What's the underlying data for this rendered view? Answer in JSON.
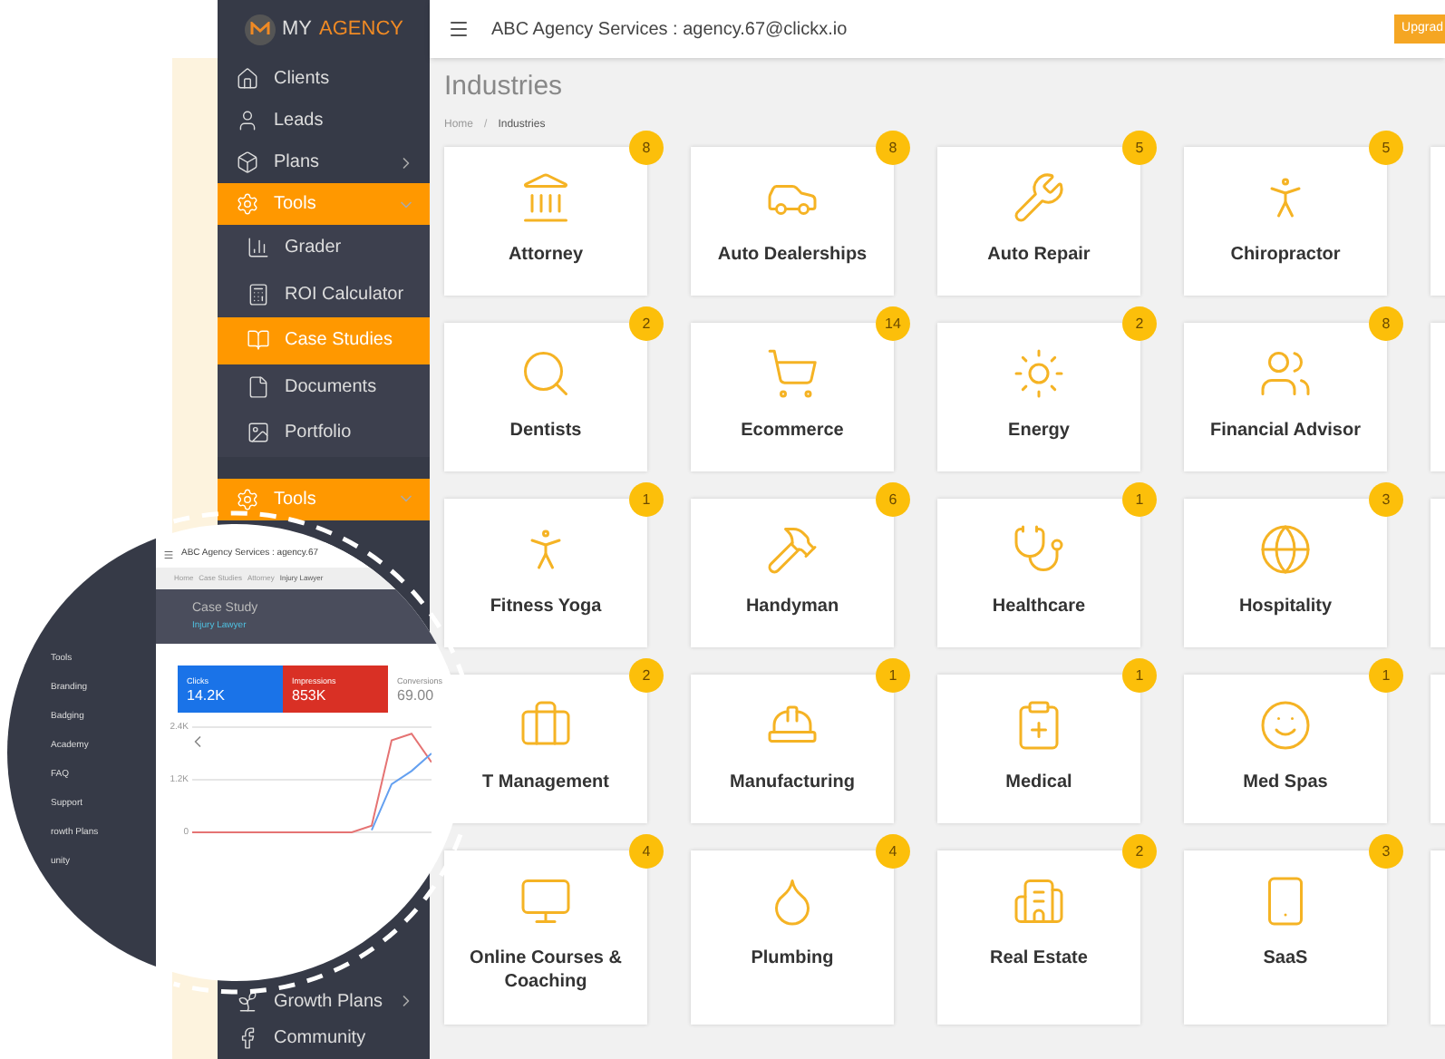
{
  "logo": {
    "prefix": "MY",
    "suffix": "AGENCY"
  },
  "sidebar": {
    "items": [
      {
        "label": "Clients",
        "kind": "main",
        "selected": false
      },
      {
        "label": "Leads",
        "kind": "main",
        "selected": false
      },
      {
        "label": "Plans",
        "kind": "main",
        "expanded": false,
        "selected": false
      },
      {
        "label": "Tools",
        "kind": "main",
        "expanded": true,
        "selected": true
      },
      {
        "label": "Grader",
        "kind": "sub",
        "selected": false
      },
      {
        "label": "ROI Calculator",
        "kind": "sub",
        "selected": false
      },
      {
        "label": "Case Studies",
        "kind": "sub",
        "selected": true
      },
      {
        "label": "Documents",
        "kind": "sub",
        "selected": false
      },
      {
        "label": "Portfolio",
        "kind": "sub",
        "selected": false
      },
      {
        "label": "Tools",
        "kind": "main",
        "expanded": true,
        "selected": true
      }
    ],
    "bottom_items": [
      {
        "label": "Growth Plans",
        "expanded": false
      },
      {
        "label": "Community"
      }
    ]
  },
  "header": {
    "title": "ABC Agency Services : agency.67@clickx.io",
    "button": "Upgrad"
  },
  "page": {
    "title": "Industries",
    "breadcrumb": [
      "Home",
      "Industries"
    ],
    "breadcrumb_separator": "/"
  },
  "cards": [
    {
      "label": "Attorney",
      "count": "8"
    },
    {
      "label": "Auto Dealerships",
      "count": "8"
    },
    {
      "label": "Auto Repair",
      "count": "5"
    },
    {
      "label": "Chiropractor",
      "count": "5"
    },
    {
      "label": "Dentists",
      "count": "2"
    },
    {
      "label": "Ecommerce",
      "count": "14"
    },
    {
      "label": "Energy",
      "count": "2"
    },
    {
      "label": "Financial Advisor",
      "count": "8"
    },
    {
      "label": "Fitness Yoga",
      "count": "1"
    },
    {
      "label": "Handyman",
      "count": "6"
    },
    {
      "label": "Healthcare",
      "count": "1"
    },
    {
      "label": "Hospitality",
      "count": "3"
    },
    {
      "label": "T Management",
      "count": "2"
    },
    {
      "label": "Manufacturing",
      "count": "1"
    },
    {
      "label": "Medical",
      "count": "1"
    },
    {
      "label": "Med Spas",
      "count": "1"
    },
    {
      "label": "Online Courses & Coaching",
      "count": "4"
    },
    {
      "label": "Plumbing",
      "count": "4"
    },
    {
      "label": "Real Estate",
      "count": "2"
    },
    {
      "label": "SaaS",
      "count": "3"
    }
  ],
  "inset": {
    "header": "ABC Agency Services : agency.67",
    "breadcrumb": [
      "Home",
      "Case Studies",
      "Attorney",
      "Injury Lawyer"
    ],
    "sidebar_items": [
      "Tools",
      "Branding",
      "Badging",
      "Academy",
      "FAQ",
      "Support",
      "rowth Plans",
      "unity"
    ],
    "title": "Case Study",
    "subtitle": "Injury Lawyer",
    "metrics": [
      {
        "label": "Clicks",
        "value": "14.2K",
        "selected": true,
        "color": "#1a73e8"
      },
      {
        "label": "Impressions",
        "value": "853K",
        "selected": true,
        "color": "#d93025"
      },
      {
        "label": "Conversions",
        "value": "69.00",
        "selected": false
      }
    ],
    "chart_data": {
      "type": "line",
      "ylim": [
        0,
        2400
      ],
      "yticks": [
        {
          "value": 2400,
          "label": "2.4K"
        },
        {
          "value": 1200,
          "label": "1.2K"
        },
        {
          "value": 0,
          "label": "0"
        }
      ],
      "series": [
        {
          "color": "#e57373",
          "values": [
            0,
            0,
            0,
            0,
            0,
            0,
            0,
            0,
            0,
            150,
            2100,
            2250,
            1600
          ]
        },
        {
          "color": "#64a0f0",
          "values": [
            null,
            null,
            null,
            null,
            null,
            null,
            null,
            null,
            null,
            50,
            1100,
            1400,
            1800
          ]
        }
      ]
    }
  }
}
